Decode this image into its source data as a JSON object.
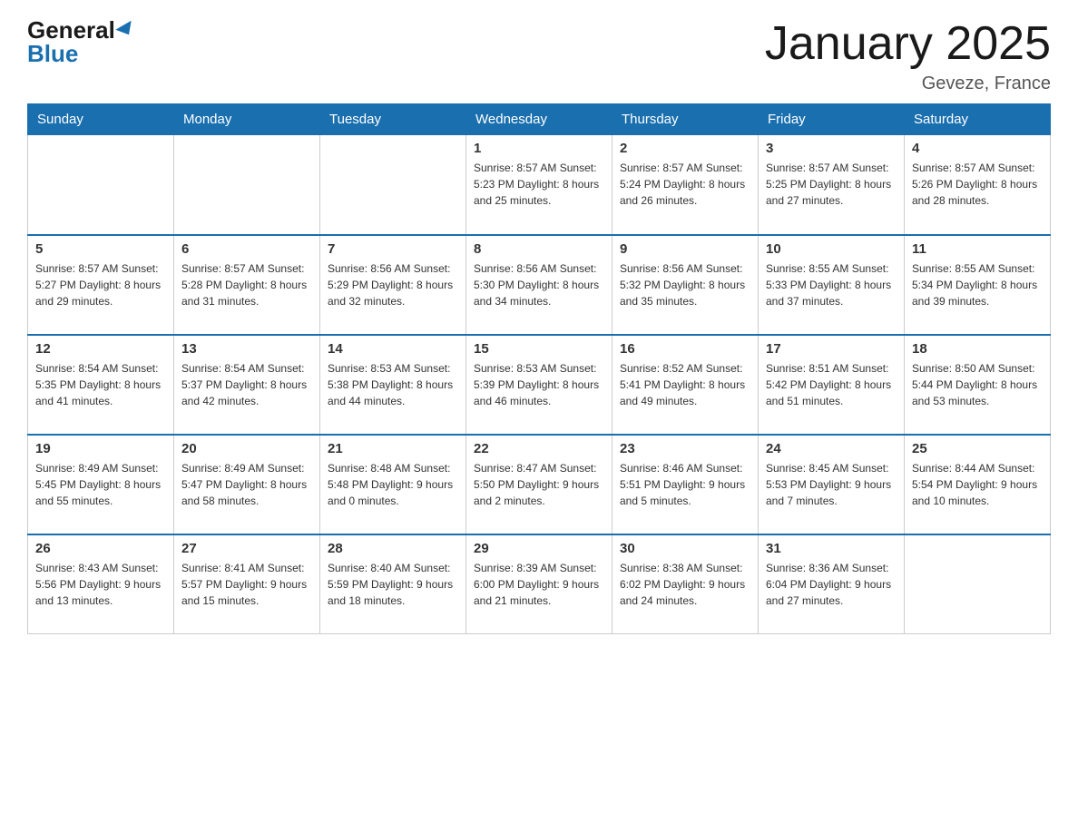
{
  "header": {
    "logo_general": "General",
    "logo_blue": "Blue",
    "month_title": "January 2025",
    "location": "Geveze, France"
  },
  "days_of_week": [
    "Sunday",
    "Monday",
    "Tuesday",
    "Wednesday",
    "Thursday",
    "Friday",
    "Saturday"
  ],
  "weeks": [
    [
      {
        "day": "",
        "info": ""
      },
      {
        "day": "",
        "info": ""
      },
      {
        "day": "",
        "info": ""
      },
      {
        "day": "1",
        "info": "Sunrise: 8:57 AM\nSunset: 5:23 PM\nDaylight: 8 hours and 25 minutes."
      },
      {
        "day": "2",
        "info": "Sunrise: 8:57 AM\nSunset: 5:24 PM\nDaylight: 8 hours and 26 minutes."
      },
      {
        "day": "3",
        "info": "Sunrise: 8:57 AM\nSunset: 5:25 PM\nDaylight: 8 hours and 27 minutes."
      },
      {
        "day": "4",
        "info": "Sunrise: 8:57 AM\nSunset: 5:26 PM\nDaylight: 8 hours and 28 minutes."
      }
    ],
    [
      {
        "day": "5",
        "info": "Sunrise: 8:57 AM\nSunset: 5:27 PM\nDaylight: 8 hours and 29 minutes."
      },
      {
        "day": "6",
        "info": "Sunrise: 8:57 AM\nSunset: 5:28 PM\nDaylight: 8 hours and 31 minutes."
      },
      {
        "day": "7",
        "info": "Sunrise: 8:56 AM\nSunset: 5:29 PM\nDaylight: 8 hours and 32 minutes."
      },
      {
        "day": "8",
        "info": "Sunrise: 8:56 AM\nSunset: 5:30 PM\nDaylight: 8 hours and 34 minutes."
      },
      {
        "day": "9",
        "info": "Sunrise: 8:56 AM\nSunset: 5:32 PM\nDaylight: 8 hours and 35 minutes."
      },
      {
        "day": "10",
        "info": "Sunrise: 8:55 AM\nSunset: 5:33 PM\nDaylight: 8 hours and 37 minutes."
      },
      {
        "day": "11",
        "info": "Sunrise: 8:55 AM\nSunset: 5:34 PM\nDaylight: 8 hours and 39 minutes."
      }
    ],
    [
      {
        "day": "12",
        "info": "Sunrise: 8:54 AM\nSunset: 5:35 PM\nDaylight: 8 hours and 41 minutes."
      },
      {
        "day": "13",
        "info": "Sunrise: 8:54 AM\nSunset: 5:37 PM\nDaylight: 8 hours and 42 minutes."
      },
      {
        "day": "14",
        "info": "Sunrise: 8:53 AM\nSunset: 5:38 PM\nDaylight: 8 hours and 44 minutes."
      },
      {
        "day": "15",
        "info": "Sunrise: 8:53 AM\nSunset: 5:39 PM\nDaylight: 8 hours and 46 minutes."
      },
      {
        "day": "16",
        "info": "Sunrise: 8:52 AM\nSunset: 5:41 PM\nDaylight: 8 hours and 49 minutes."
      },
      {
        "day": "17",
        "info": "Sunrise: 8:51 AM\nSunset: 5:42 PM\nDaylight: 8 hours and 51 minutes."
      },
      {
        "day": "18",
        "info": "Sunrise: 8:50 AM\nSunset: 5:44 PM\nDaylight: 8 hours and 53 minutes."
      }
    ],
    [
      {
        "day": "19",
        "info": "Sunrise: 8:49 AM\nSunset: 5:45 PM\nDaylight: 8 hours and 55 minutes."
      },
      {
        "day": "20",
        "info": "Sunrise: 8:49 AM\nSunset: 5:47 PM\nDaylight: 8 hours and 58 minutes."
      },
      {
        "day": "21",
        "info": "Sunrise: 8:48 AM\nSunset: 5:48 PM\nDaylight: 9 hours and 0 minutes."
      },
      {
        "day": "22",
        "info": "Sunrise: 8:47 AM\nSunset: 5:50 PM\nDaylight: 9 hours and 2 minutes."
      },
      {
        "day": "23",
        "info": "Sunrise: 8:46 AM\nSunset: 5:51 PM\nDaylight: 9 hours and 5 minutes."
      },
      {
        "day": "24",
        "info": "Sunrise: 8:45 AM\nSunset: 5:53 PM\nDaylight: 9 hours and 7 minutes."
      },
      {
        "day": "25",
        "info": "Sunrise: 8:44 AM\nSunset: 5:54 PM\nDaylight: 9 hours and 10 minutes."
      }
    ],
    [
      {
        "day": "26",
        "info": "Sunrise: 8:43 AM\nSunset: 5:56 PM\nDaylight: 9 hours and 13 minutes."
      },
      {
        "day": "27",
        "info": "Sunrise: 8:41 AM\nSunset: 5:57 PM\nDaylight: 9 hours and 15 minutes."
      },
      {
        "day": "28",
        "info": "Sunrise: 8:40 AM\nSunset: 5:59 PM\nDaylight: 9 hours and 18 minutes."
      },
      {
        "day": "29",
        "info": "Sunrise: 8:39 AM\nSunset: 6:00 PM\nDaylight: 9 hours and 21 minutes."
      },
      {
        "day": "30",
        "info": "Sunrise: 8:38 AM\nSunset: 6:02 PM\nDaylight: 9 hours and 24 minutes."
      },
      {
        "day": "31",
        "info": "Sunrise: 8:36 AM\nSunset: 6:04 PM\nDaylight: 9 hours and 27 minutes."
      },
      {
        "day": "",
        "info": ""
      }
    ]
  ]
}
